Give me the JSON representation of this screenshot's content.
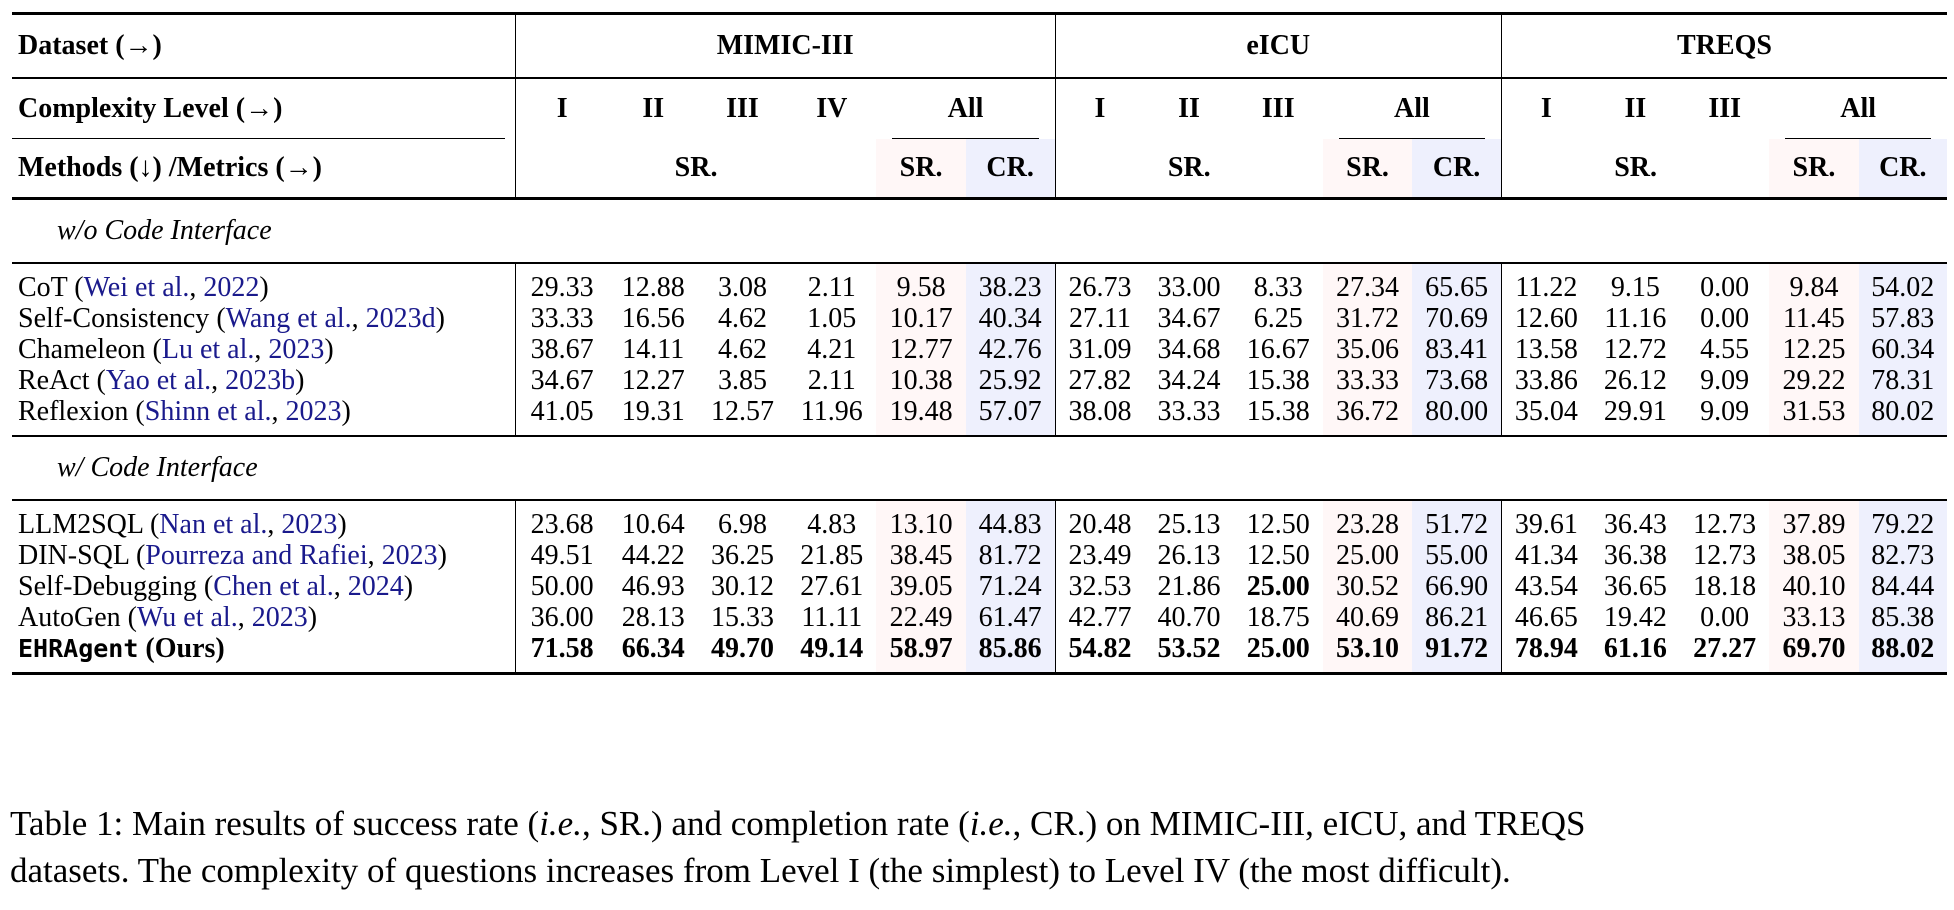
{
  "header": {
    "dataset_label": "Dataset (→)",
    "complexity_label": "Complexity Level (→)",
    "methods_label": "Methods (↓) /Metrics (→)",
    "datasets": [
      {
        "name": "MIMIC-III",
        "levels": [
          "I",
          "II",
          "III",
          "IV"
        ],
        "all_label": "All",
        "sr_label": "SR.",
        "all_sr_label": "SR.",
        "all_cr_label": "CR."
      },
      {
        "name": "eICU",
        "levels": [
          "I",
          "II",
          "III"
        ],
        "all_label": "All",
        "sr_label": "SR.",
        "all_sr_label": "SR.",
        "all_cr_label": "CR."
      },
      {
        "name": "TREQS",
        "levels": [
          "I",
          "II",
          "III"
        ],
        "all_label": "All",
        "sr_label": "SR.",
        "all_sr_label": "SR.",
        "all_cr_label": "CR."
      }
    ]
  },
  "sections": [
    {
      "title": "w/o Code Interface",
      "rows": [
        {
          "method": "CoT",
          "cite_author": "Wei et al.",
          "cite_year": "2022",
          "mimic": [
            "29.33",
            "12.88",
            "3.08",
            "2.11",
            "9.58",
            "38.23"
          ],
          "eicu": [
            "26.73",
            "33.00",
            "8.33",
            "27.34",
            "65.65"
          ],
          "treqs": [
            "11.22",
            "9.15",
            "0.00",
            "9.84",
            "54.02"
          ]
        },
        {
          "method": "Self-Consistency",
          "cite_author": "Wang et al.",
          "cite_year": "2023d",
          "mimic": [
            "33.33",
            "16.56",
            "4.62",
            "1.05",
            "10.17",
            "40.34"
          ],
          "eicu": [
            "27.11",
            "34.67",
            "6.25",
            "31.72",
            "70.69"
          ],
          "treqs": [
            "12.60",
            "11.16",
            "0.00",
            "11.45",
            "57.83"
          ]
        },
        {
          "method": "Chameleon",
          "cite_author": "Lu et al.",
          "cite_year": "2023",
          "mimic": [
            "38.67",
            "14.11",
            "4.62",
            "4.21",
            "12.77",
            "42.76"
          ],
          "eicu": [
            "31.09",
            "34.68",
            "16.67",
            "35.06",
            "83.41"
          ],
          "treqs": [
            "13.58",
            "12.72",
            "4.55",
            "12.25",
            "60.34"
          ]
        },
        {
          "method": "ReAct",
          "cite_author": "Yao et al.",
          "cite_year": "2023b",
          "mimic": [
            "34.67",
            "12.27",
            "3.85",
            "2.11",
            "10.38",
            "25.92"
          ],
          "eicu": [
            "27.82",
            "34.24",
            "15.38",
            "33.33",
            "73.68"
          ],
          "treqs": [
            "33.86",
            "26.12",
            "9.09",
            "29.22",
            "78.31"
          ]
        },
        {
          "method": "Reflexion",
          "cite_author": "Shinn et al.",
          "cite_year": "2023",
          "mimic": [
            "41.05",
            "19.31",
            "12.57",
            "11.96",
            "19.48",
            "57.07"
          ],
          "eicu": [
            "38.08",
            "33.33",
            "15.38",
            "36.72",
            "80.00"
          ],
          "treqs": [
            "35.04",
            "29.91",
            "9.09",
            "31.53",
            "80.02"
          ]
        }
      ]
    },
    {
      "title": "w/ Code Interface",
      "rows": [
        {
          "method": "LLM2SQL",
          "cite_author": "Nan et al.",
          "cite_year": "2023",
          "mimic": [
            "23.68",
            "10.64",
            "6.98",
            "4.83",
            "13.10",
            "44.83"
          ],
          "eicu": [
            "20.48",
            "25.13",
            "12.50",
            "23.28",
            "51.72"
          ],
          "treqs": [
            "39.61",
            "36.43",
            "12.73",
            "37.89",
            "79.22"
          ]
        },
        {
          "method": "DIN-SQL",
          "cite_author": "Pourreza and Rafiei",
          "cite_year": "2023",
          "mimic": [
            "49.51",
            "44.22",
            "36.25",
            "21.85",
            "38.45",
            "81.72"
          ],
          "eicu": [
            "23.49",
            "26.13",
            "12.50",
            "25.00",
            "55.00"
          ],
          "treqs": [
            "41.34",
            "36.38",
            "12.73",
            "38.05",
            "82.73"
          ]
        },
        {
          "method": "Self-Debugging",
          "cite_author": "Chen et al.",
          "cite_year": "2024",
          "mimic": [
            "50.00",
            "46.93",
            "30.12",
            "27.61",
            "39.05",
            "71.24"
          ],
          "eicu": [
            "32.53",
            "21.86",
            "25.00",
            "30.52",
            "66.90"
          ],
          "eicu_bold": [
            false,
            false,
            true,
            false,
            false
          ],
          "treqs": [
            "43.54",
            "36.65",
            "18.18",
            "40.10",
            "84.44"
          ]
        },
        {
          "method": "AutoGen",
          "cite_author": "Wu et al.",
          "cite_year": "2023",
          "mimic": [
            "36.00",
            "28.13",
            "15.33",
            "11.11",
            "22.49",
            "61.47"
          ],
          "eicu": [
            "42.77",
            "40.70",
            "18.75",
            "40.69",
            "86.21"
          ],
          "treqs": [
            "46.65",
            "19.42",
            "0.00",
            "33.13",
            "85.38"
          ]
        }
      ]
    }
  ],
  "ours": {
    "method": "EHRAgent",
    "suffix": "(Ours)",
    "mimic": [
      "71.58",
      "66.34",
      "49.70",
      "49.14",
      "58.97",
      "85.86"
    ],
    "eicu": [
      "54.82",
      "53.52",
      "25.00",
      "53.10",
      "91.72"
    ],
    "treqs": [
      "78.94",
      "61.16",
      "27.27",
      "69.70",
      "88.02"
    ]
  },
  "caption": {
    "p1": "Table 1: Main results of success rate (",
    "ie1": "i.e.",
    "p2": ", SR.) and completion rate (",
    "ie2": "i.e.",
    "p3": ", CR.) on MIMIC-III, eICU, and TREQS",
    "line2": "datasets. The complexity of questions increases from Level I (the simplest) to Level IV (the most difficult)."
  },
  "colors": {
    "citation": "#1a1a8c",
    "sr_highlight": "#fff7f7",
    "cr_highlight": "#eef0fd"
  }
}
